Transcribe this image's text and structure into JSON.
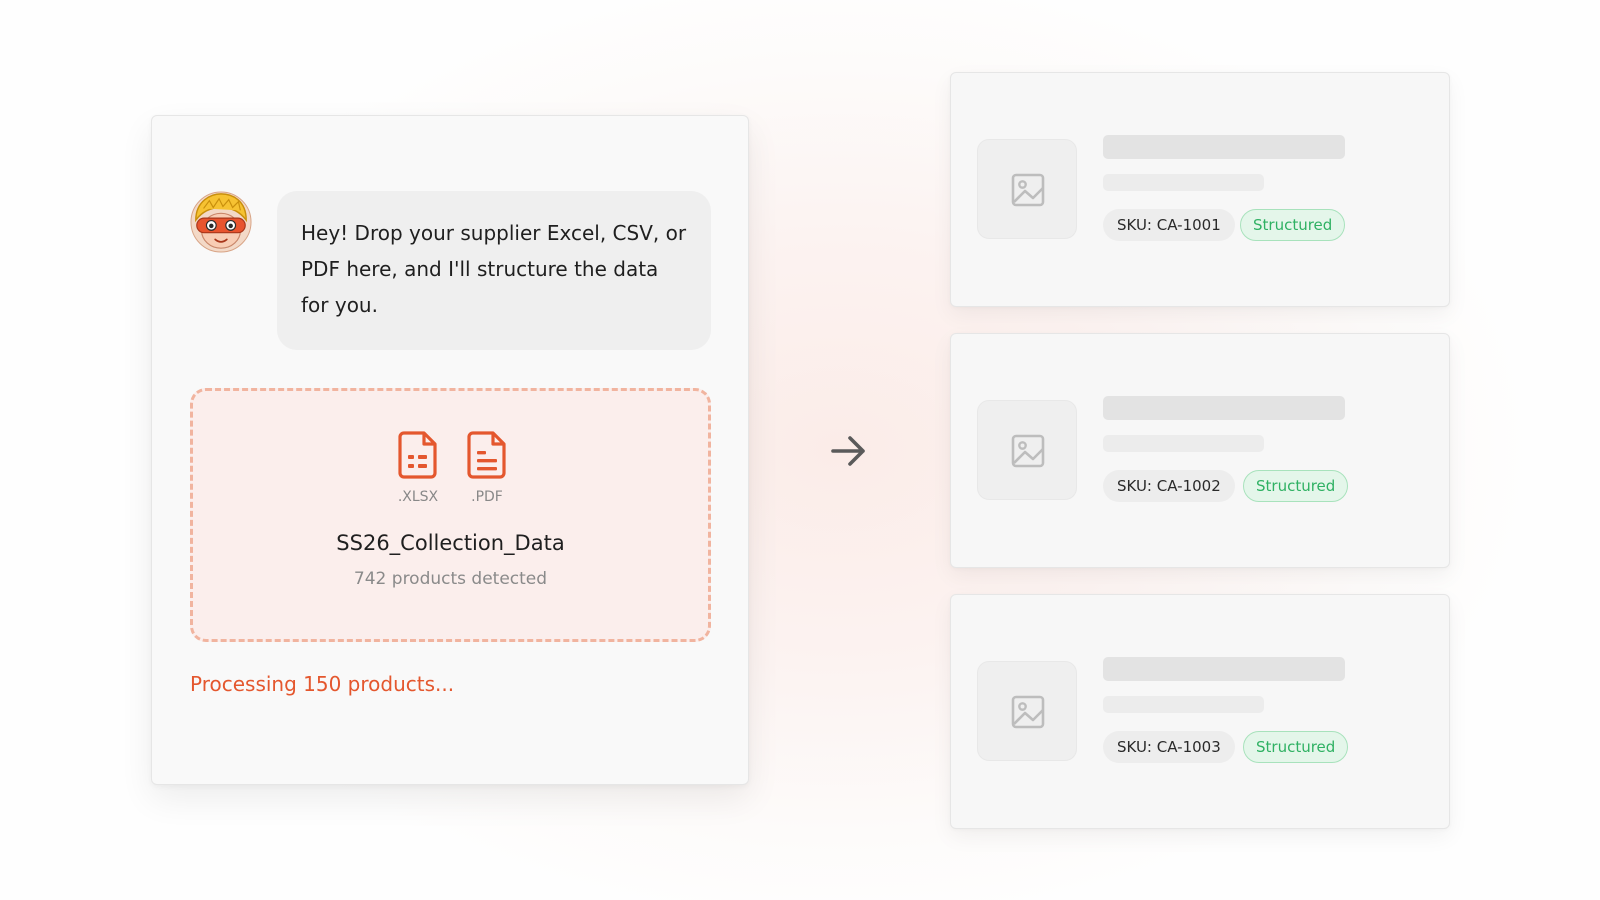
{
  "chat": {
    "avatar_icon": "mascot-avatar-icon",
    "message": "Hey! Drop your supplier Excel, CSV, or PDF here, and I'll structure the data for you."
  },
  "upload": {
    "files": [
      {
        "ext": ".XLSX",
        "icon": "spreadsheet-file-icon"
      },
      {
        "ext": ".PDF",
        "icon": "document-file-icon"
      }
    ],
    "file_name": "SS26_Collection_Data",
    "product_count": "742 products detected",
    "accent_color": "#e4572e"
  },
  "status": {
    "text": "Processing 150 products..."
  },
  "flow": {
    "arrow_icon": "arrow-right-icon"
  },
  "products": [
    {
      "sku": "SKU: CA-1001",
      "status": "Structured",
      "image_icon": "image-placeholder-icon"
    },
    {
      "sku": "SKU: CA-1002",
      "status": "Structured",
      "image_icon": "image-placeholder-icon"
    },
    {
      "sku": "SKU: CA-1003",
      "status": "Structured",
      "image_icon": "image-placeholder-icon"
    }
  ],
  "colors": {
    "accent": "#e4572e",
    "success_text": "#2fb163",
    "success_bg": "#e4f6ea"
  }
}
